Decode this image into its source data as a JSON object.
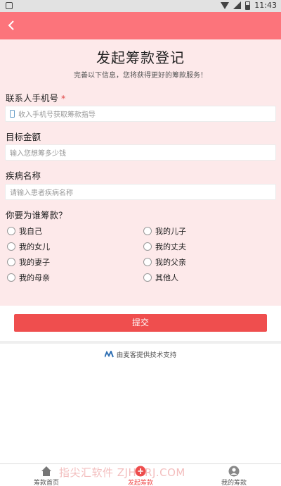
{
  "status_bar": {
    "time": "11:43"
  },
  "header": {
    "title": "发起筹款登记",
    "subtitle": "完善以下信息，您将获得更好的筹款服务！"
  },
  "form": {
    "phone": {
      "label": "联系人手机号",
      "required_mark": "*",
      "placeholder": "收入手机号获取筹款指导"
    },
    "amount": {
      "label": "目标金额",
      "placeholder": "输入您想筹多少钱"
    },
    "disease": {
      "label": "疾病名称",
      "placeholder": "请输入患者疾病名称"
    },
    "beneficiary": {
      "question": "你要为谁筹款？",
      "options": [
        "我自己",
        "我的儿子",
        "我的女儿",
        "我的丈夫",
        "我的妻子",
        "我的父亲",
        "我的母亲",
        "其他人"
      ]
    }
  },
  "submit_label": "提交",
  "powered_by": "由麦客提供技术支持",
  "tabs": [
    {
      "label": "筹款首页",
      "icon": "home-icon"
    },
    {
      "label": "发起筹款",
      "icon": "plus-circle-icon",
      "active": true
    },
    {
      "label": "我的筹款",
      "icon": "user-icon"
    }
  ],
  "watermark": "指尖汇软件 ZJHHRJ.COM",
  "colors": {
    "header_bar": "#fc747b",
    "form_bg": "#fde9ea",
    "submit": "#ef4e4e",
    "active_tab": "#ef4e4e"
  }
}
